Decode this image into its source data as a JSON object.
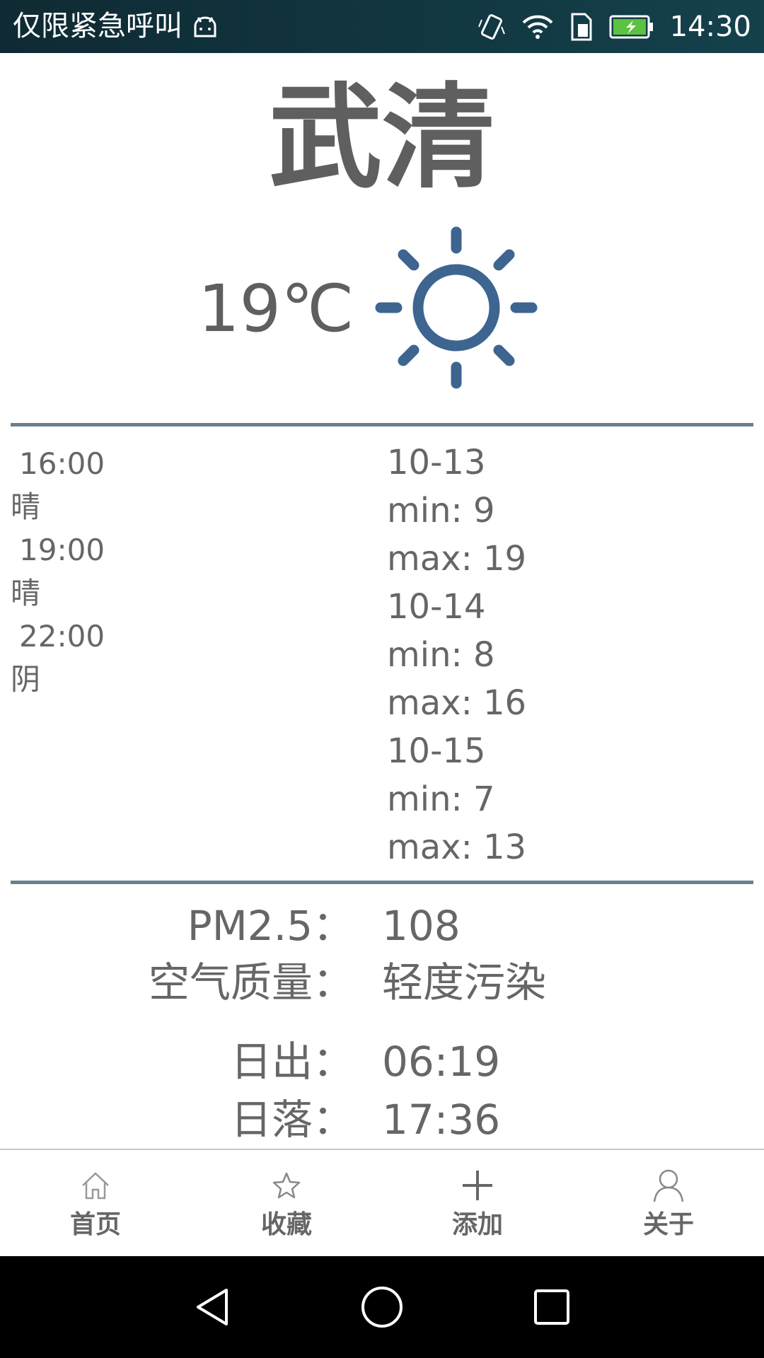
{
  "status_bar": {
    "left_text": "仅限紧急呼叫",
    "time": "14:30",
    "icons": [
      "android-icon",
      "vibrate-icon",
      "wifi-icon",
      "sim-icon",
      "battery-charging-icon"
    ]
  },
  "city": "武清",
  "current": {
    "temperature": "19℃",
    "icon": "sun-icon"
  },
  "hourly": [
    {
      "time": "16:00",
      "condition": "晴"
    },
    {
      "time": "19:00",
      "condition": "晴"
    },
    {
      "time": "22:00",
      "condition": "阴"
    }
  ],
  "daily": [
    {
      "date": "10-13",
      "min": "min: 9",
      "max": "max: 19"
    },
    {
      "date": "10-14",
      "min": "min: 8",
      "max": "max: 16"
    },
    {
      "date": "10-15",
      "min": "min: 7",
      "max": "max: 13"
    }
  ],
  "air": {
    "pm25_label": "PM2.5：",
    "pm25_value": "108",
    "quality_label": "空气质量：",
    "quality_value": "轻度污染"
  },
  "sun": {
    "sunrise_label": "日出：",
    "sunrise_value": "06:19",
    "sunset_label": "日落：",
    "sunset_value": "17:36"
  },
  "tabs": [
    {
      "label": "首页",
      "icon": "home-icon"
    },
    {
      "label": "收藏",
      "icon": "star-icon"
    },
    {
      "label": "添加",
      "icon": "plus-icon"
    },
    {
      "label": "关于",
      "icon": "person-icon"
    }
  ],
  "colors": {
    "accent": "#3d6590",
    "divider": "#6b7f8e",
    "text": "#666666"
  }
}
